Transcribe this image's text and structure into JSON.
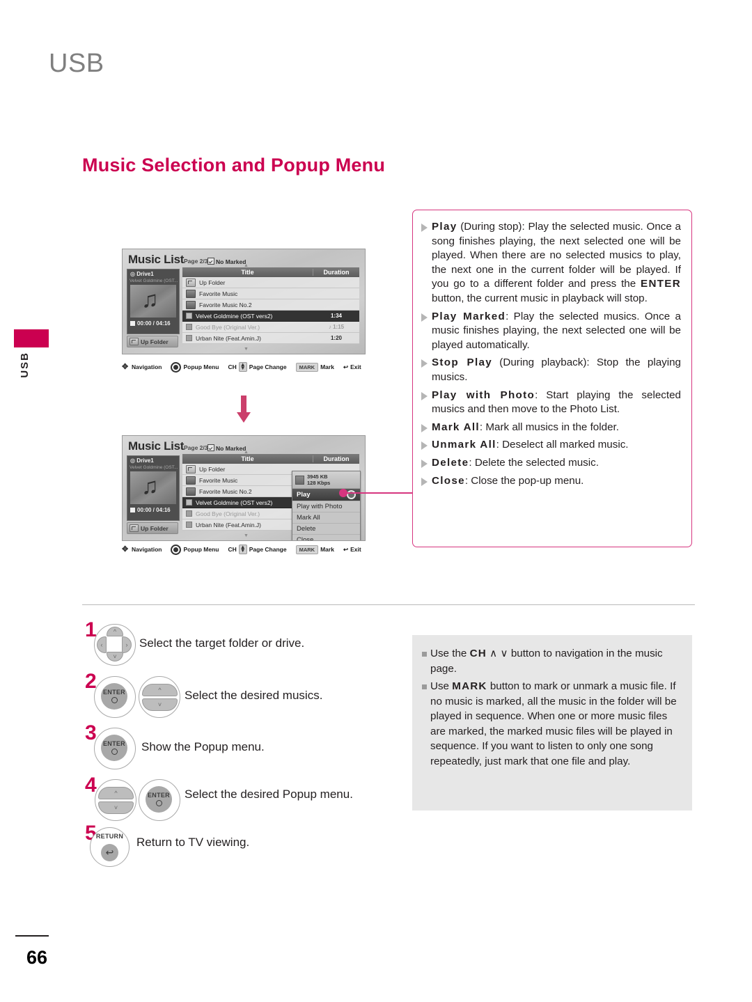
{
  "page": {
    "header": "USB",
    "side_tab_label": "USB",
    "number": "66",
    "section_title": "Music Selection and Popup Menu"
  },
  "screenshot": {
    "title": "Music List",
    "page_indicator": "Page 2/3",
    "marked_status": "No Marked",
    "drive": {
      "name": "Drive1",
      "now_playing": "Velvet Goldmine (OST...",
      "time": "00:00 / 04:16",
      "up_folder_button": "Up Folder"
    },
    "columns": {
      "title": "Title",
      "duration": "Duration"
    },
    "rows": [
      {
        "label": "Up Folder",
        "duration": "",
        "icon": "up-folder-icon",
        "state": "normal"
      },
      {
        "label": "Favorite Music",
        "duration": "",
        "icon": "folder-icon",
        "state": "normal"
      },
      {
        "label": "Favorite Music No.2",
        "duration": "",
        "icon": "folder-icon",
        "state": "normal"
      },
      {
        "label": "Velvet Goldmine (OST vers2)",
        "duration": "1:34",
        "icon": "mark-box-icon",
        "state": "selected"
      },
      {
        "label": "Good Bye (Original Ver.)",
        "duration": "1:15",
        "icon": "mark-box-icon",
        "state": "dim"
      },
      {
        "label": "Urban Nite (Feat.Amin.J)",
        "duration": "1:20",
        "icon": "mark-box-icon",
        "state": "normal"
      }
    ],
    "legend": {
      "navigation": "Navigation",
      "popup_menu": "Popup Menu",
      "ch": "CH",
      "page_change": "Page Change",
      "mark_key": "MARK",
      "mark": "Mark",
      "exit": "Exit"
    },
    "popup": {
      "file_size": "3945 KB",
      "bitrate": "128 Kbps",
      "items": [
        "Play",
        "Play with Photo",
        "Mark All",
        "Delete",
        "Close"
      ],
      "highlighted": "Play"
    }
  },
  "callout": {
    "items": [
      {
        "term": "Play",
        "rest": " (During stop): Play the selected music. Once a song finishes playing, the next selected one will be played. When there are no selected musics to play, the next one in the current folder will be played. If you go to a different folder and press the ENTER button, the current music in playback will stop.",
        "emphasis": "ENTER"
      },
      {
        "term": "Play Marked",
        "rest": ": Play the selected musics. Once a music finishes playing, the next selected one will be played automatically."
      },
      {
        "term": "Stop Play",
        "rest": " (During playback): Stop the playing musics."
      },
      {
        "term": "Play with Photo",
        "rest": ": Start playing the selected musics and then move to the Photo List."
      },
      {
        "term": "Mark All",
        "rest": ": Mark all musics in the folder."
      },
      {
        "term": "Unmark All",
        "rest": ": Deselect all marked music."
      },
      {
        "term": "Delete",
        "rest": ": Delete the selected music."
      },
      {
        "term": "Close",
        "rest": ": Close the pop-up menu."
      }
    ]
  },
  "notes": {
    "items": [
      {
        "pre": "Use the ",
        "key": "CH",
        "mid": " ∧ ∨ ",
        "rest": "button to navigation in the music page."
      },
      {
        "pre": "Use ",
        "key": "MARK",
        "mid": " ",
        "rest": "button to mark or unmark a music file. If no music is marked, all the music in the folder will be played in sequence. When one or more music files are marked, the marked music files will be played in sequence. If you want to listen to only one song repeatedly, just mark that one file and play."
      }
    ]
  },
  "steps": [
    {
      "num": "1",
      "text": "Select the target folder or drive.",
      "buttons": [
        "dpad"
      ]
    },
    {
      "num": "2",
      "text": "Select the desired musics.",
      "buttons": [
        "enter",
        "updown"
      ]
    },
    {
      "num": "3",
      "text": "Show the Popup menu.",
      "buttons": [
        "enter"
      ]
    },
    {
      "num": "4",
      "text": "Select the desired Popup menu.",
      "buttons": [
        "updown",
        "enter"
      ]
    },
    {
      "num": "5",
      "text": "Return to TV viewing.",
      "buttons": [
        "return"
      ]
    }
  ],
  "button_labels": {
    "enter": "ENTER",
    "return": "RETURN"
  },
  "colors": {
    "accent": "#cb0050",
    "callout_border": "#d6357f",
    "note_bg": "#e7e7e7"
  }
}
